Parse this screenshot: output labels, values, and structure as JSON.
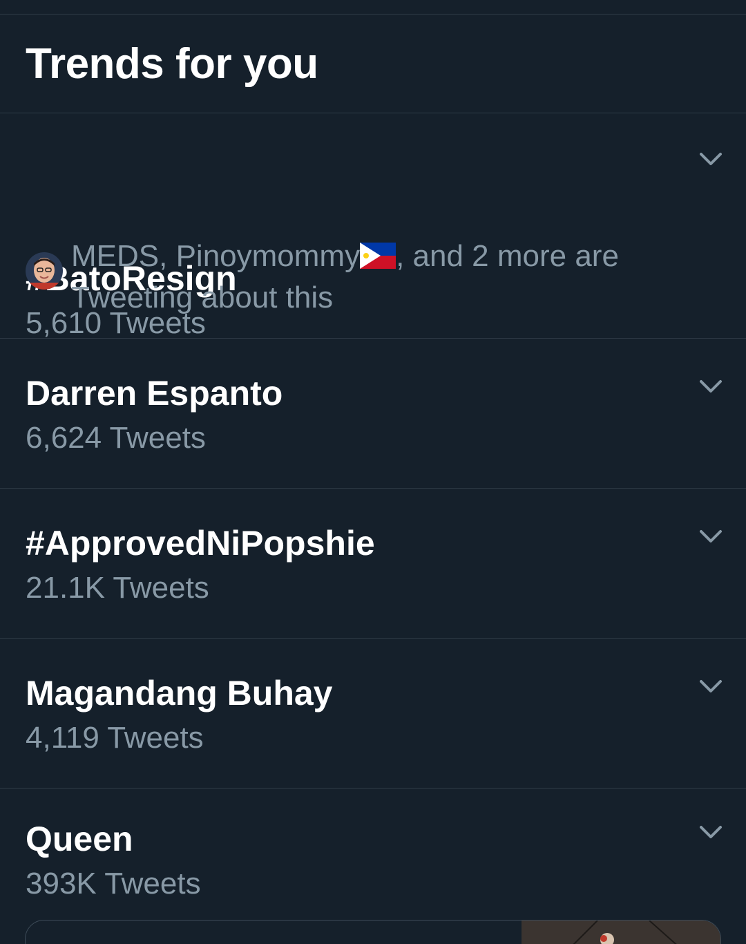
{
  "header": {
    "title": "Trends for you"
  },
  "trends": [
    {
      "title": "#BatoResign",
      "count": "5,610 Tweets"
    },
    {
      "title": "Darren Espanto",
      "count": "6,624 Tweets"
    },
    {
      "title": "#ApprovedNiPopshie",
      "count": "21.1K Tweets"
    },
    {
      "title": "Magandang Buhay",
      "count": "4,119 Tweets"
    },
    {
      "title": "Queen",
      "count": "393K Tweets"
    }
  ],
  "social_context": {
    "names": "MEDS, Pinoymommy",
    "suffix": ", and 2 more are",
    "line2": "Tweeting about this"
  },
  "colors": {
    "background": "#15202b",
    "divider": "#2f3b47",
    "primary_text": "#ffffff",
    "secondary_text": "#8899a6"
  },
  "icons": {
    "caret": "chevron-down-icon",
    "avatar": "avatar",
    "flag": "philippines-flag-icon",
    "thumbnail": "media-thumbnail"
  }
}
